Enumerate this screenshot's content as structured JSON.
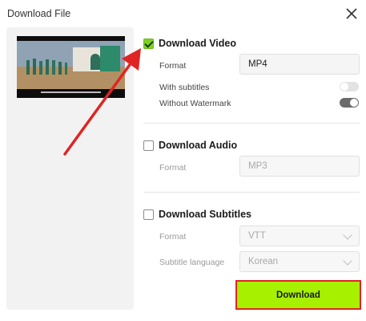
{
  "dialog": {
    "title": "Download File"
  },
  "video": {
    "title": "Download Video",
    "checked": true,
    "format_label": "Format",
    "format_value": "MP4",
    "subtitles_label": "With subtitles",
    "subtitles_on": false,
    "watermark_label": "Without Watermark",
    "watermark_on": true
  },
  "audio": {
    "title": "Download Audio",
    "checked": false,
    "format_label": "Format",
    "format_value": "MP3"
  },
  "subtitles": {
    "title": "Download Subtitles",
    "checked": false,
    "format_label": "Format",
    "format_value": "VTT",
    "language_label": "Subtitle language",
    "language_value": "Korean"
  },
  "actions": {
    "download_label": "Download"
  },
  "colors": {
    "accent": "#a6f000",
    "annotation": "#e02424",
    "check": "#7ed321"
  },
  "icons": {
    "close": "close-icon",
    "annotation_arrow": "arrow-annotation"
  }
}
